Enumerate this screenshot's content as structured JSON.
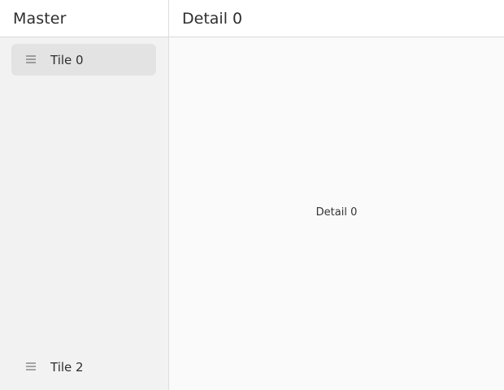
{
  "master": {
    "title": "Master",
    "tiles": [
      {
        "label": "Tile 0",
        "icon": "menu-lines-icon",
        "selected": true
      },
      {
        "label": "Tile 2",
        "icon": "menu-lines-icon",
        "selected": false
      }
    ]
  },
  "detail": {
    "title": "Detail 0",
    "body_text": "Detail 0"
  },
  "colors": {
    "master_bg": "#f2f2f2",
    "detail_bg": "#fafafa",
    "selected_tile_bg": "#e3e3e3",
    "header_bg": "#ffffff"
  }
}
